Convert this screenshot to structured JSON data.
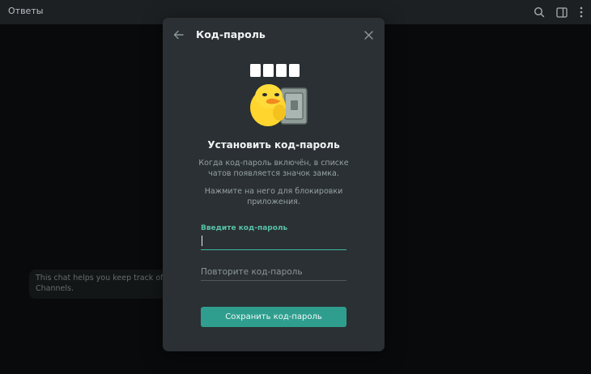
{
  "topbar": {
    "title": "Ответы",
    "icons": [
      "search-icon",
      "sidebar-toggle-icon",
      "more-vertical-icon"
    ]
  },
  "background": {
    "info_line1": "This chat helps you keep track of repli",
    "info_line2": "Channels."
  },
  "modal": {
    "title": "Код-пароль",
    "heading": "Установить код-пароль",
    "description1": "Когда код-пароль включён, в списке чатов появляется значок замка.",
    "description2": "Нажмите на него для блокировки приложения.",
    "field1_label": "Введите код-пароль",
    "field1_value": "",
    "field2_placeholder": "Повторите код-пароль",
    "save_label": "Сохранить код-пароль"
  },
  "colors": {
    "accent": "#3fb8a5",
    "button": "#2f9e8e",
    "modal_bg": "#2a3033",
    "app_bg": "#0e1011"
  }
}
